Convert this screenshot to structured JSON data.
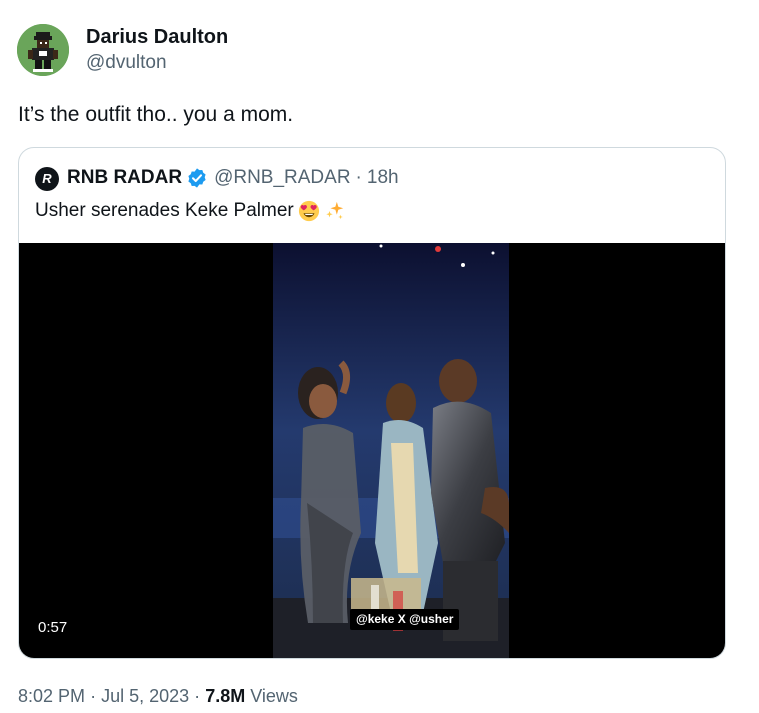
{
  "tweet": {
    "author": {
      "name": "Darius Daulton",
      "handle": "@dvulton",
      "avatar_icon": "pixel-art-avatar"
    },
    "text": "It’s the outfit tho.. you a mom.",
    "time": "8:02 PM",
    "date": "Jul 5, 2023",
    "separator": "·",
    "views_count": "7.8M",
    "views_label": "Views"
  },
  "quote": {
    "logo_letter": "R",
    "name": "RNB RADAR",
    "handle": "@RNB_RADAR",
    "separator": "·",
    "time": "18h",
    "text": "Usher serenades Keke Palmer",
    "emojis": [
      "heart-eyes-emoji",
      "sparkles-emoji"
    ],
    "verified_icon": "verified-badge-icon"
  },
  "video": {
    "duration": "0:57",
    "caption": "@keke X @usher"
  },
  "colors": {
    "text_primary": "#0f1419",
    "text_secondary": "#536471",
    "border": "#cfd9de",
    "verified_blue": "#1d9bf0",
    "avatar_bg": "#6aa55a"
  }
}
